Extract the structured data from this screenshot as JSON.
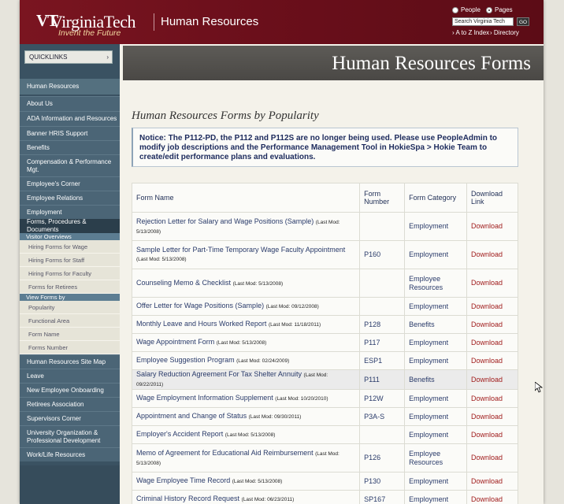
{
  "header": {
    "logo_mark": "VT",
    "logo_word": "VirginiaTech",
    "logo_tagline": "Invent the Future",
    "unit_name": "Human Resources",
    "search": {
      "radio_people": "People",
      "radio_pages": "Pages",
      "input_value": "Search Virginia Tech",
      "go_label": "GO"
    },
    "links": [
      "A to Z Index",
      "Directory"
    ]
  },
  "sidebar": {
    "quicklinks_label": "QUICKLINKS",
    "quicklinks_arrow": "›",
    "hr_label": "Human Resources",
    "items_top": [
      "About Us",
      "ADA Information and Resources",
      "Banner HRIS Support",
      "Benefits",
      "Compensation & Performance Mgt.",
      "Employee's Corner",
      "Employee Relations",
      "Employment",
      "Forms, Procedures & Documents"
    ],
    "visitor_heading": "Visitor Overviews",
    "visitor_items": [
      "Hiring Forms for Wage",
      "Hiring Forms for Staff",
      "Hiring Forms for Faculty",
      "Forms for Retirees"
    ],
    "view_heading": "View Forms by",
    "view_items": [
      "Popularity",
      "Functional Area",
      "Form Name",
      "Forms Number"
    ],
    "items_bottom": [
      "Human Resources Site Map",
      "Leave",
      "New Employee Onboarding",
      "Retirees Association",
      "Supervisors Corner",
      "University Organization & Professional Development",
      "Work/Life Resources"
    ]
  },
  "banner": {
    "title": "Human Resources Forms"
  },
  "main": {
    "heading": "Human Resources Forms by Popularity",
    "notice": "Notice: The P112-PD, the P112 and P112S are no longer being used. Please use PeopleAdmin to modify job descriptions and the Performance Management Tool in HokieSpa > Hokie Team to create/edit performance plans and evaluations."
  },
  "table": {
    "headers": [
      "Form Name",
      "Form Number",
      "Form Category",
      "Download Link"
    ],
    "rows": [
      {
        "name": "Rejection Letter for Salary and Wage Positions (Sample)",
        "mod": "(Last Mod: 5/13/2008)",
        "number": "",
        "category": "Employment",
        "link": "Download"
      },
      {
        "name": "Sample Letter for Part-Time Temporary Wage Faculty Appointment",
        "mod": "(Last Mod: 5/13/2008)",
        "number": "P160",
        "category": "Employment",
        "link": "Download"
      },
      {
        "name": "Counseling Memo & Checklist",
        "mod": "(Last Mod: 5/13/2008)",
        "number": "",
        "category": "Employee Resources",
        "link": "Download"
      },
      {
        "name": "Offer Letter for Wage Positions (Sample)",
        "mod": "(Last Mod: 09/12/2008)",
        "number": "",
        "category": "Employment",
        "link": "Download"
      },
      {
        "name": "Monthly Leave and Hours Worked Report",
        "mod": "(Last Mod: 11/18/2011)",
        "number": "P128",
        "category": "Benefits",
        "link": "Download"
      },
      {
        "name": "Wage Appointment Form",
        "mod": "(Last Mod: 5/13/2008)",
        "number": "P117",
        "category": "Employment",
        "link": "Download"
      },
      {
        "name": "Employee Suggestion Program",
        "mod": "(Last Mod: 02/24/2009)",
        "number": "ESP1",
        "category": "Employment",
        "link": "Download"
      },
      {
        "name": "Salary Reduction Agreement For Tax Shelter Annuity",
        "mod": "(Last Mod: 09/22/2011)",
        "number": "P111",
        "category": "Benefits",
        "link": "Download"
      },
      {
        "name": "Wage Employment Information Supplement",
        "mod": "(Last Mod: 10/20/2010)",
        "number": "P12W",
        "category": "Employment",
        "link": "Download"
      },
      {
        "name": "Appointment and Change of Status",
        "mod": "(Last Mod: 09/30/2011)",
        "number": "P3A-S",
        "category": "Employment",
        "link": "Download"
      },
      {
        "name": "Employer's Accident Report",
        "mod": "(Last Mod: 5/13/2008)",
        "number": "",
        "category": "Employment",
        "link": "Download"
      },
      {
        "name": "Memo of Agreement for Educational Aid Reimbursement",
        "mod": "(Last Mod: 5/13/2008)",
        "number": "P126",
        "category": "Employee Resources",
        "link": "Download"
      },
      {
        "name": "Wage Employee Time Record",
        "mod": "(Last Mod: 5/13/2008)",
        "number": "P130",
        "category": "Employment",
        "link": "Download"
      },
      {
        "name": "Criminal History Record Request",
        "mod": "(Last Mod: 06/23/2011)",
        "number": "SP167",
        "category": "Employment",
        "link": "Download"
      }
    ]
  }
}
